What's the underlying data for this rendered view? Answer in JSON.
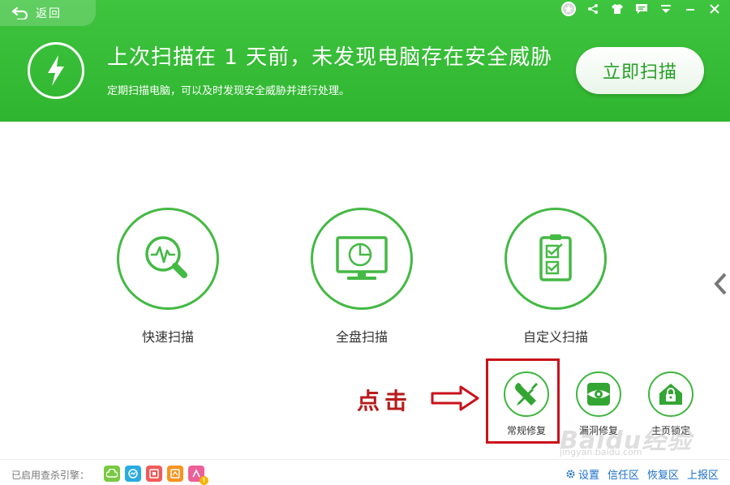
{
  "header": {
    "back_label": "返回",
    "headline": "上次扫描在 1 天前，未发现电脑存在安全威胁",
    "subline": "定期扫描电脑，可以及时发现安全威胁并进行处理。",
    "scan_button": "立即扫描"
  },
  "window_controls": [
    {
      "icon": "medal-icon"
    },
    {
      "icon": "share-icon"
    },
    {
      "icon": "skin-icon"
    },
    {
      "icon": "message-icon"
    },
    {
      "icon": "menu-icon"
    },
    {
      "icon": "minimize-icon"
    },
    {
      "icon": "close-icon"
    }
  ],
  "scan_modes": [
    {
      "label": "快速扫描",
      "icon": "quick-scan-icon"
    },
    {
      "label": "全盘扫描",
      "icon": "full-scan-icon"
    },
    {
      "label": "自定义扫描",
      "icon": "custom-scan-icon"
    }
  ],
  "tools": [
    {
      "label": "常规修复",
      "icon": "repair-tools-icon"
    },
    {
      "label": "漏洞修复",
      "icon": "vulnerability-fix-icon"
    },
    {
      "label": "主页锁定",
      "icon": "homepage-lock-icon"
    }
  ],
  "annotation": {
    "click_text": "点击"
  },
  "footer": {
    "engine_label": "已启用查杀引擎：",
    "engines": [
      {
        "icon": "cloud-engine-icon",
        "color": "#7ac943"
      },
      {
        "icon": "qvm-engine-icon",
        "color": "#29abe2"
      },
      {
        "icon": "qex-engine-icon",
        "color": "#f15a5a"
      },
      {
        "icon": "system-repair-engine-icon",
        "color": "#f7931e"
      },
      {
        "icon": "avira-engine-icon",
        "color": "#ec5f98"
      }
    ],
    "links": {
      "settings": "设置",
      "trust": "信任区",
      "restore": "恢复区",
      "report": "上报区"
    }
  },
  "watermark": {
    "text": "Baidu经验",
    "url": "jingyan.baidu.com"
  },
  "colors": {
    "brand_green": "#33b833",
    "highlight_red": "#c9121b"
  }
}
